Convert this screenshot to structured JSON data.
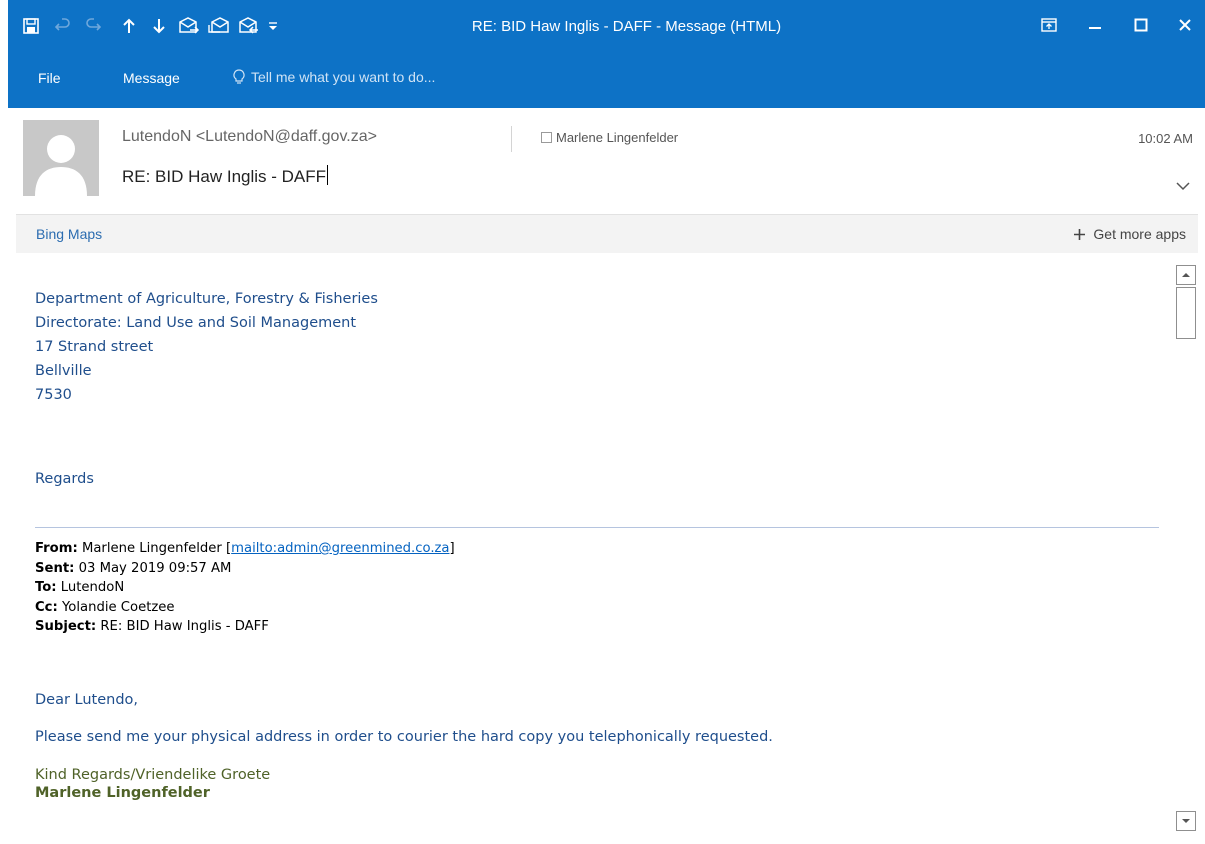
{
  "window": {
    "title": "RE: BID Haw Inglis - DAFF - Message (HTML)"
  },
  "ribbon": {
    "tabs": [
      "File",
      "Message"
    ],
    "tell_me": "Tell me what you want to do..."
  },
  "header": {
    "sender": "LutendoN <LutendoN@daff.gov.za>",
    "recipient": "Marlene Lingenfelder",
    "time": "10:02 AM",
    "subject": "RE: BID Haw Inglis - DAFF"
  },
  "apps_bar": {
    "app": "Bing Maps",
    "get_more": "Get more apps"
  },
  "body": {
    "address_lines": [
      "Department of Agriculture, Forestry & Fisheries",
      "Directorate: Land Use and Soil Management",
      "17 Strand street",
      "Bellville",
      "7530"
    ],
    "regards": "Regards"
  },
  "quoted": {
    "from_label": "From:",
    "from_name": "Marlene Lingenfelder [",
    "from_link": "mailto:admin@greenmined.co.za",
    "from_end": "]",
    "sent_label": "Sent:",
    "sent": "03 May 2019 09:57 AM",
    "to_label": "To:",
    "to": "LutendoN",
    "cc_label": "Cc:",
    "cc": "Yolandie Coetzee",
    "subject_label": "Subject:",
    "subject": "RE: BID Haw Inglis - DAFF",
    "greeting": "Dear Lutendo,",
    "message": "Please send me your physical address in order to courier the hard copy you telephonically requested.",
    "signoff": "Kind Regards/Vriendelike Groete",
    "signature_name": "Marlene Lingenfelder"
  },
  "colors": {
    "titlebar": "#0d72c6",
    "body_text": "#1f4e8c",
    "signature": "#4f6228",
    "link": "#0563c1"
  }
}
